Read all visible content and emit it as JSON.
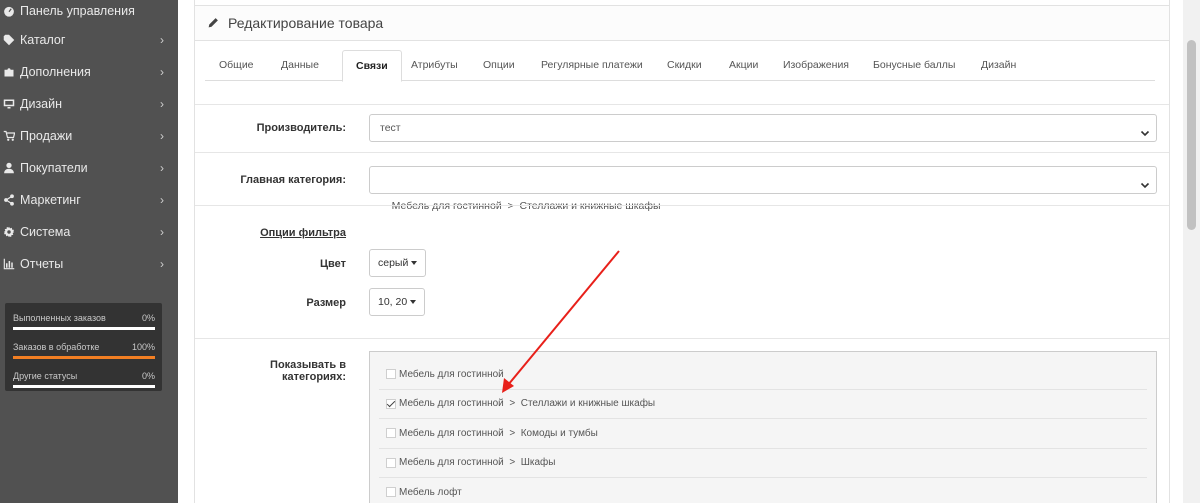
{
  "sidebar": {
    "items": [
      {
        "label": "Панель управления",
        "icon": "dashboard-icon",
        "has_children": false
      },
      {
        "label": "Каталог",
        "icon": "tag-icon",
        "has_children": true
      },
      {
        "label": "Дополнения",
        "icon": "puzzle-icon",
        "has_children": true
      },
      {
        "label": "Дизайн",
        "icon": "monitor-icon",
        "has_children": true
      },
      {
        "label": "Продажи",
        "icon": "cart-icon",
        "has_children": true
      },
      {
        "label": "Покупатели",
        "icon": "user-icon",
        "has_children": true
      },
      {
        "label": "Маркетинг",
        "icon": "share-icon",
        "has_children": true
      },
      {
        "label": "Система",
        "icon": "cog-icon",
        "has_children": true
      },
      {
        "label": "Отчеты",
        "icon": "bar-chart-icon",
        "has_children": true
      }
    ],
    "stats": [
      {
        "label": "Выполненных заказов",
        "value": "0%",
        "progress": 0
      },
      {
        "label": "Заказов в обработке",
        "value": "100%",
        "progress": 100
      },
      {
        "label": "Другие статусы",
        "value": "0%",
        "progress": 0
      }
    ]
  },
  "panel": {
    "title": "Редактирование товара",
    "icon": "pencil-icon"
  },
  "tabs": [
    {
      "label": "Общие",
      "active": false
    },
    {
      "label": "Данные",
      "active": false
    },
    {
      "label": "Связи",
      "active": true
    },
    {
      "label": "Атрибуты",
      "active": false
    },
    {
      "label": "Опции",
      "active": false
    },
    {
      "label": "Регулярные платежи",
      "active": false
    },
    {
      "label": "Скидки",
      "active": false
    },
    {
      "label": "Акции",
      "active": false
    },
    {
      "label": "Изображения",
      "active": false
    },
    {
      "label": "Бонусные баллы",
      "active": false
    },
    {
      "label": "Дизайн",
      "active": false
    }
  ],
  "form": {
    "manufacturer_label": "Производитель:",
    "manufacturer_value": "тест",
    "main_category_label": "Главная категория:",
    "main_category_value": "Мебель для гостинной  >  Стеллажи и книжные шкафы",
    "filter_options_label": "Опции фильтра",
    "color_label": "Цвет",
    "color_value": "серый",
    "size_label": "Размер",
    "size_value": "10, 20",
    "show_in_categories_label": "Показывать в категориях:",
    "categories": [
      {
        "label": "Мебель для гостинной",
        "checked": false
      },
      {
        "label": "Мебель для гостинной  >  Стеллажи и книжные шкафы",
        "checked": true
      },
      {
        "label": "Мебель для гостинной  >  Комоды и тумбы",
        "checked": false
      },
      {
        "label": "Мебель для гостинной  >  Шкафы",
        "checked": false
      },
      {
        "label": "Мебель лофт",
        "checked": false
      }
    ]
  },
  "colors": {
    "sidebar_bg": "#515151",
    "stats_bg": "#333333",
    "progress_fill": "#f27f23",
    "annotation_arrow": "#e8201a"
  }
}
